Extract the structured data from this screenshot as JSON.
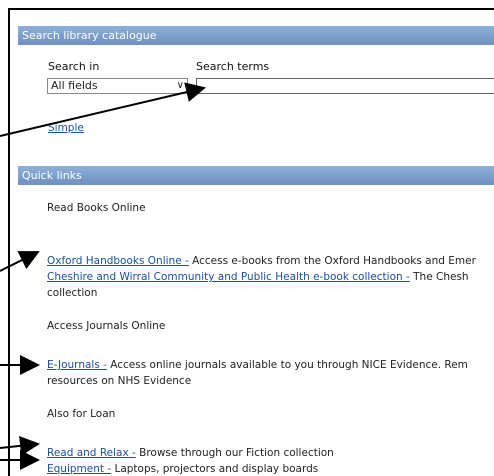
{
  "search": {
    "header": "Search library catalogue",
    "search_in_label": "Search in",
    "search_terms_label": "Search terms",
    "field_value": "All fields",
    "terms_value": "",
    "simple_link": "Simple"
  },
  "quick_links": {
    "header": "Quick links",
    "read_books_heading": "Read Books Online",
    "oxford_link": "Oxford Handbooks Online -",
    "oxford_desc": " Access e-books from the Oxford Handbooks and Emer",
    "cheshire_link": "Cheshire and Wirral Community and Public Health e-book collection -",
    "cheshire_desc": " The Chesh",
    "cheshire_desc2": "collection",
    "access_journals_heading": "Access Journals Online",
    "ejournals_link": "E-Journals -",
    "ejournals_desc": " Access online journals available to you through NICE Evidence. Rem",
    "ejournals_desc2": "resources on NHS Evidence",
    "loan_heading": "Also for Loan",
    "relax_link": "Read and Relax -",
    "relax_desc": " Browse through our Fiction collection",
    "equipment_link": "Equipment -",
    "equipment_desc": " Laptops, projectors and display boards"
  }
}
